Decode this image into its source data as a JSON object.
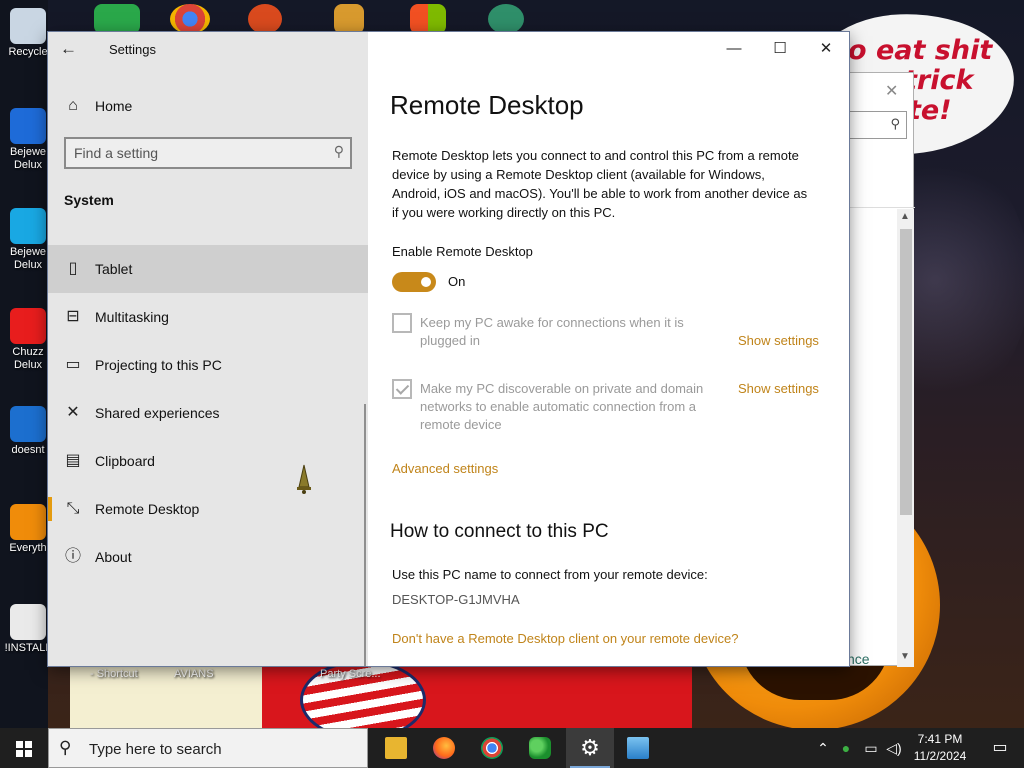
{
  "desktop": {
    "speech_text": "o eat shit\ntrick\nte!",
    "icons": [
      {
        "label": "Recycle",
        "color": "#c9d6e3"
      },
      {
        "label": "Bejewe\nDelux",
        "color": "#1e6bd8"
      },
      {
        "label": "Bejewe\nDelux",
        "color": "#19a8e3"
      },
      {
        "label": "Chuzz\nDelux",
        "color": "#e81d1d"
      },
      {
        "label": "doesnt",
        "color": "#1c6fcf"
      },
      {
        "label": "Everyth",
        "color": "#f08c0a"
      },
      {
        "label": "!INSTALL",
        "color": "#eaeaea"
      }
    ],
    "bottom_labels": {
      "shortcut": "- Shortcut",
      "avians": "AVIANS",
      "party": "Party Scre..."
    },
    "bg_window_fragment": "nce"
  },
  "settings": {
    "app_title": "Settings",
    "home_label": "Home",
    "find_placeholder": "Find a setting",
    "section": "System",
    "nav": [
      {
        "label": "Tablet",
        "icon": "tablet-icon"
      },
      {
        "label": "Multitasking",
        "icon": "multitasking-icon"
      },
      {
        "label": "Projecting to this PC",
        "icon": "projecting-icon"
      },
      {
        "label": "Shared experiences",
        "icon": "shared-experiences-icon"
      },
      {
        "label": "Clipboard",
        "icon": "clipboard-icon"
      },
      {
        "label": "Remote Desktop",
        "icon": "remote-desktop-icon"
      },
      {
        "label": "About",
        "icon": "about-icon"
      }
    ],
    "selected_nav": "Remote Desktop",
    "hovered_nav": "Tablet"
  },
  "content": {
    "title": "Remote Desktop",
    "description": "Remote Desktop lets you connect to and control this PC from a remote device by using a Remote Desktop client (available for Windows, Android, iOS and macOS). You'll be able to work from another device as if you were working directly on this PC.",
    "enable_label": "Enable Remote Desktop",
    "toggle_state": "On",
    "toggle_on": true,
    "option1": "Keep my PC awake for connections when it is plugged in",
    "option1_checked": false,
    "option2": "Make my PC discoverable on private and domain networks to enable automatic connection from a remote device",
    "option2_checked": true,
    "show_settings": "Show settings",
    "advanced": "Advanced settings",
    "how_title": "How to connect to this PC",
    "use_name": "Use this PC name to connect from your remote device:",
    "pc_name": "DESKTOP-G1JMVHA",
    "no_client_link": "Don't have a Remote Desktop client on your remote device?",
    "accent_color": "#c8891a"
  },
  "taskbar": {
    "search_placeholder": "Type here to search",
    "time": "7:41 PM",
    "date": "11/2/2024"
  }
}
